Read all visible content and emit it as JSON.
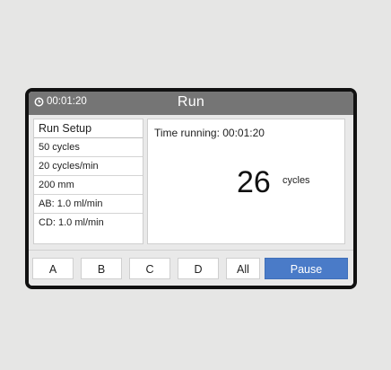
{
  "titlebar": {
    "elapsed": "00:01:20",
    "title": "Run",
    "icon": "clock-icon"
  },
  "setup": {
    "header": "Run Setup",
    "items": [
      "50  cycles",
      "20  cycles/min",
      "200  mm",
      "AB: 1.0  ml/min",
      "CD: 1.0  ml/min"
    ]
  },
  "main": {
    "time_running": "Time running:  00:01:20",
    "cycle_count": "26",
    "cycle_unit": "cycles"
  },
  "buttons": {
    "a": "A",
    "b": "B",
    "c": "C",
    "d": "D",
    "all": "All",
    "pause": "Pause"
  },
  "colors": {
    "titlebar": "#757575",
    "pause_button": "#4a7bc8",
    "bezel": "#111111"
  }
}
